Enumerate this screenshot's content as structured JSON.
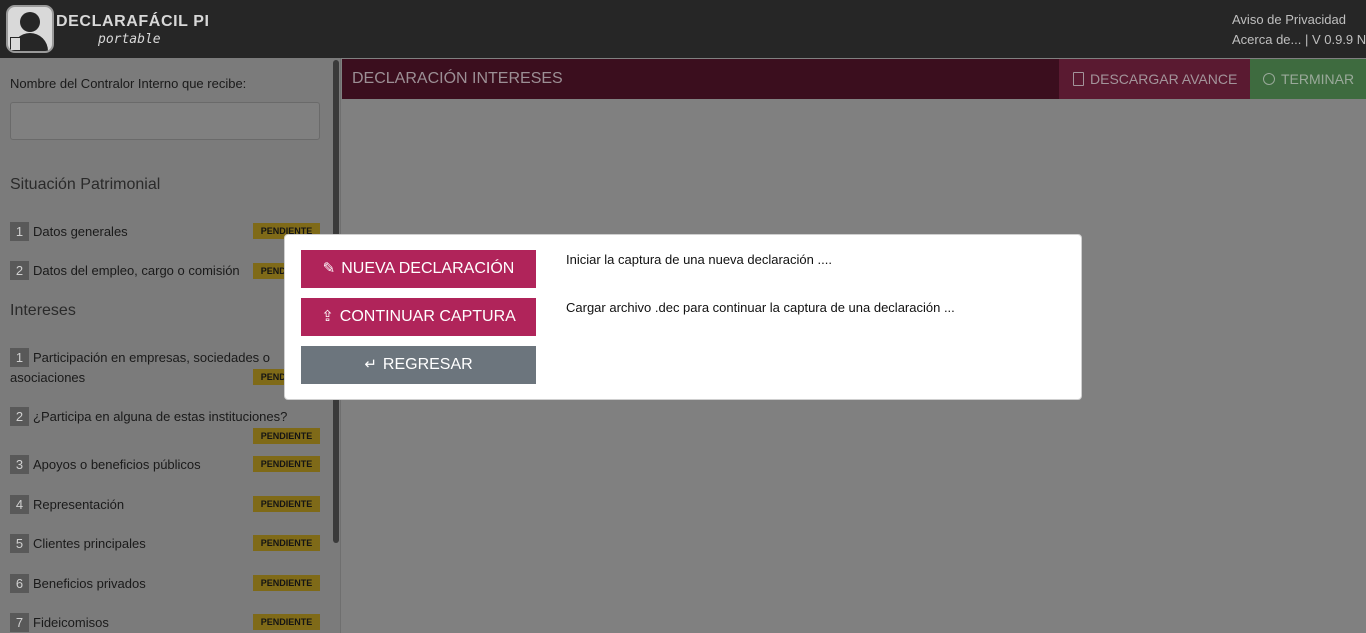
{
  "header": {
    "brand": "DECLARAFÁCIL PI",
    "brand_sub": "portable",
    "link_privacy": "Aviso de Privacidad",
    "link_about": "Acerca de... | V 0.9.9 N"
  },
  "sidebar": {
    "controller_label": "Nombre del Contralor Interno que recibe:",
    "controller_value": "",
    "section_patrimonial": "Situación Patrimonial",
    "section_intereses": "Intereses",
    "status": "PENDIENTE",
    "patrimonial_items": [
      {
        "num": "1",
        "label": "Datos generales"
      },
      {
        "num": "2",
        "label": "Datos del empleo, cargo o comisión"
      }
    ],
    "intereses_items": [
      {
        "num": "1",
        "label": "Participación en empresas, sociedades o asociaciones"
      },
      {
        "num": "2",
        "label": "¿Participa en alguna de estas instituciones?"
      },
      {
        "num": "3",
        "label": "Apoyos o beneficios públicos"
      },
      {
        "num": "4",
        "label": "Representación"
      },
      {
        "num": "5",
        "label": "Clientes principales"
      },
      {
        "num": "6",
        "label": "Beneficios privados"
      },
      {
        "num": "7",
        "label": "Fideicomisos"
      }
    ]
  },
  "main": {
    "title": "DECLARACIÓN INTERESES",
    "download_label": "DESCARGAR AVANCE",
    "finish_label": "TERMINAR"
  },
  "modal": {
    "new_label": "NUEVA DECLARACIÓN",
    "new_desc": "Iniciar la captura de una nueva declaración ....",
    "continue_label": "CONTINUAR CAPTURA",
    "continue_desc": "Cargar archivo .dec para continuar la captura de una declaración ...",
    "back_label": "REGRESAR"
  },
  "colors": {
    "primary": "#b0245a",
    "secondary": "#6c757d",
    "badge": "#e8c22a",
    "success": "#5cb85c"
  }
}
